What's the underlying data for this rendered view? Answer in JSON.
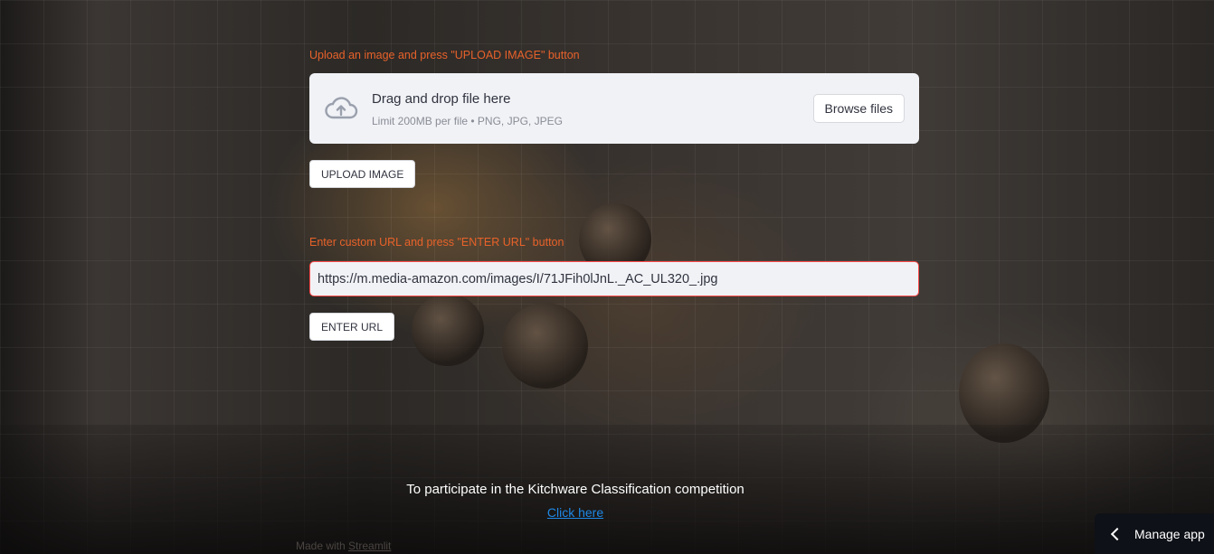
{
  "upload": {
    "instruction": "Upload an image and press \"UPLOAD IMAGE\" button",
    "dropzone_title": "Drag and drop file here",
    "dropzone_limit": "Limit 200MB per file • PNG, JPG, JPEG",
    "browse_label": "Browse files",
    "upload_button": "UPLOAD IMAGE",
    "icon": "cloud-upload-icon"
  },
  "url": {
    "instruction": "Enter custom URL and press \"ENTER URL\" button",
    "value": "https://m.media-amazon.com/images/I/71JFih0lJnL._AC_UL320_.jpg",
    "enter_button": "ENTER URL"
  },
  "footer": {
    "participate_text": "To participate in the Kitchware Classification competition",
    "link_text": "Click here",
    "made_with_prefix": "Made with ",
    "made_with_link": "Streamlit"
  },
  "manage_app": {
    "label": "Manage app",
    "icon": "chevron-left-icon"
  },
  "colors": {
    "accent_orange": "#e8622a",
    "input_border": "#ff4b4b",
    "link_blue": "#1e88e5",
    "panel_bg": "#f0f2f6"
  }
}
